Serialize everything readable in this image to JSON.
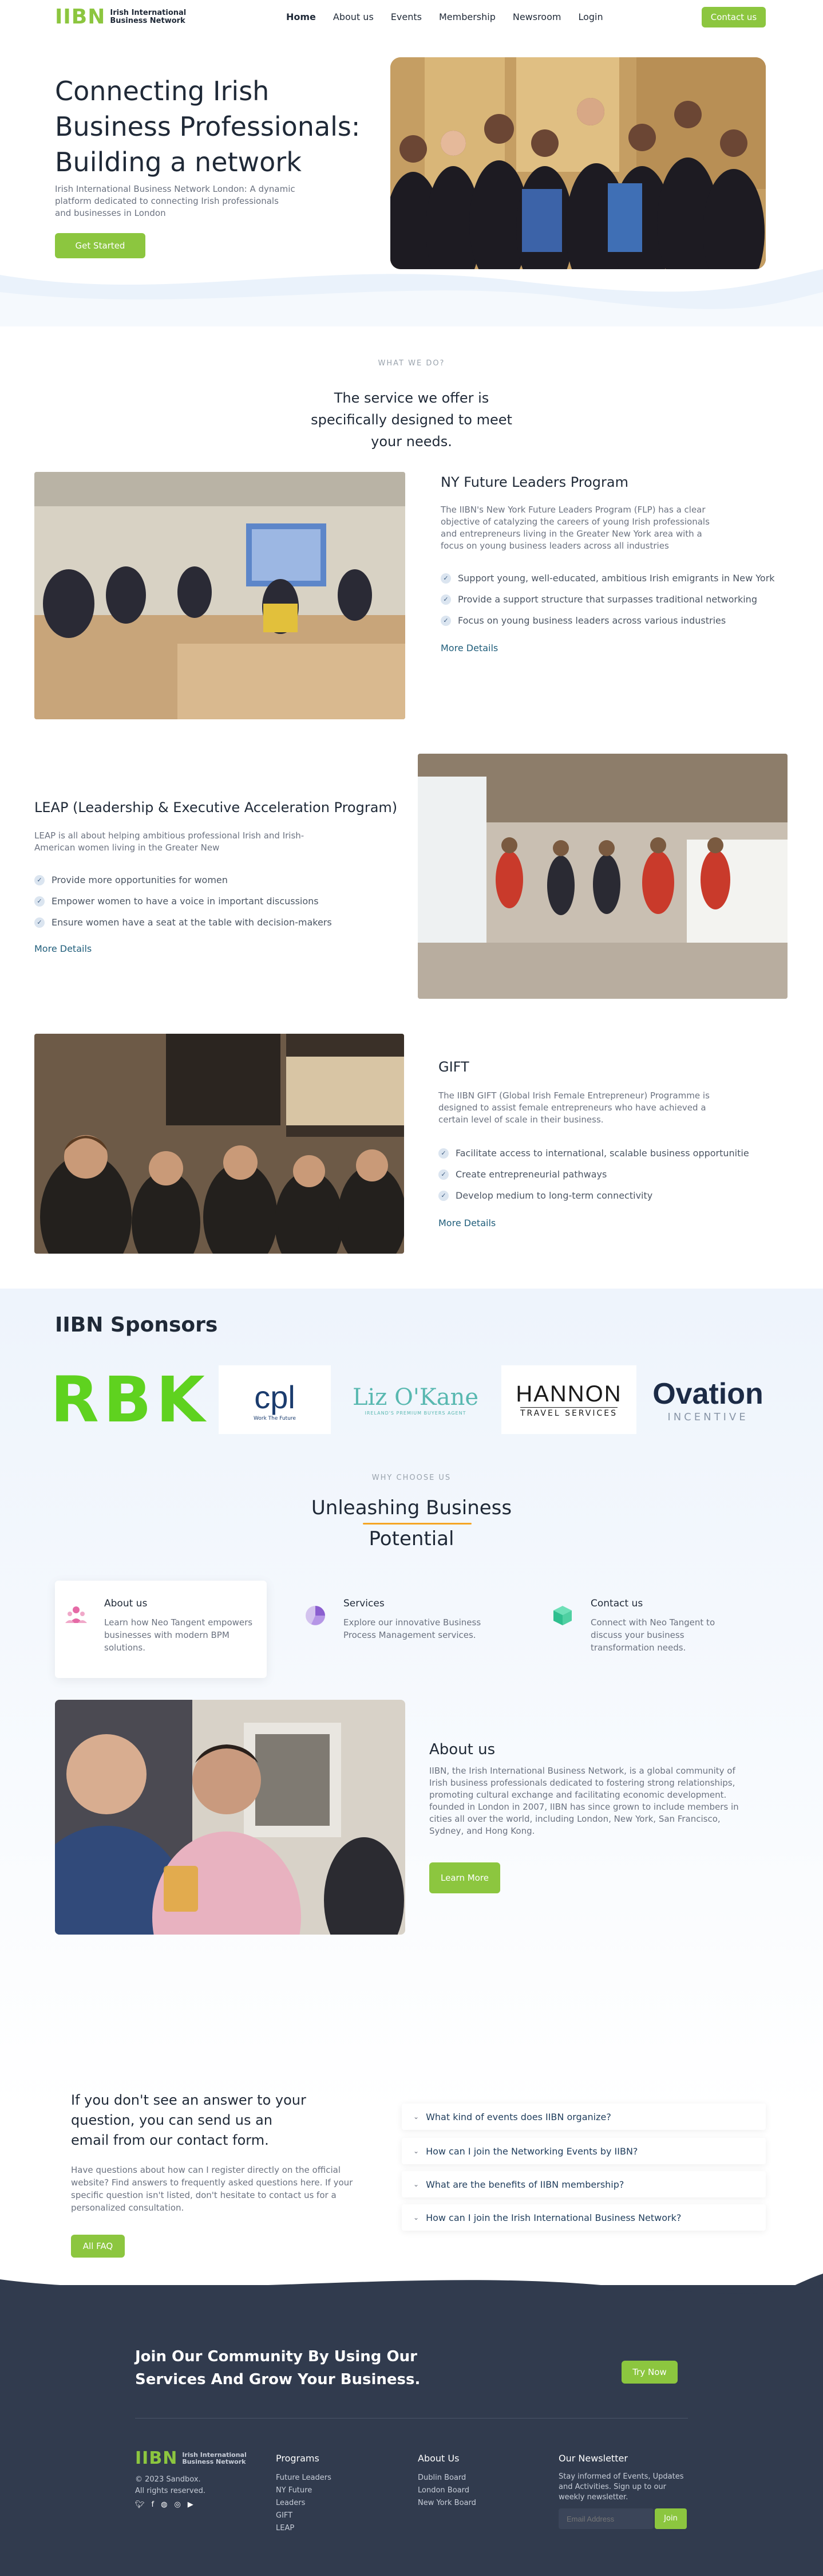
{
  "header": {
    "logo_mark": "IIBN",
    "logo_text_1": "Irish International",
    "logo_text_2": "Business Network",
    "nav": [
      "Home",
      "About us",
      "Events",
      "Membership",
      "Newsroom",
      "Login"
    ],
    "contact_label": "Contact us"
  },
  "hero": {
    "title": "Connecting Irish Business Professionals: Building a network",
    "subtitle": "Irish International Business Network London: A dynamic platform dedicated to connecting Irish professionals and businesses in London",
    "cta": "Get Started"
  },
  "services": {
    "eyebrow": "WHAT WE DO?",
    "title": "The service we offer is specifically designed to meet your needs."
  },
  "programs": [
    {
      "title": "NY Future Leaders Program",
      "desc": "The IIBN's New York Future Leaders Program (FLP) has a clear objective of catalyzing the careers of young Irish professionals and entrepreneurs living in the Greater New York area with a focus on young business leaders across all industries",
      "points": [
        "Support young, well-educated, ambitious Irish emigrants in New York",
        "Provide a support structure that surpasses traditional networking",
        "Focus on young business leaders across various industries"
      ],
      "more": "More Details"
    },
    {
      "title": "LEAP (Leadership & Executive Acceleration Program)",
      "desc": "LEAP is all about helping ambitious professional Irish and Irish-American women living in the Greater New",
      "points": [
        "Provide more opportunities for women",
        "Empower women to have a voice in important discussions",
        "Ensure women have a seat at the table with decision-makers"
      ],
      "more": "More Details"
    },
    {
      "title": "GIFT",
      "desc": "The IIBN GIFT (Global Irish Female Entrepreneur) Programme is designed to assist female entrepreneurs who have achieved a certain level of scale in their business.",
      "points": [
        "Facilitate access to international, scalable business opportunitie",
        "Create entrepreneurial pathways",
        "Develop medium to long-term connectivity"
      ],
      "more": "More Details"
    }
  ],
  "sponsors": {
    "title": "IIBN Sponsors",
    "logos": [
      {
        "name": "RBK",
        "text": "RBK"
      },
      {
        "name": "cpl",
        "text": "cpl",
        "sub": "Work The Future"
      },
      {
        "name": "liz-okane",
        "text": "Liz O'Kane",
        "sub": "IRELAND'S PREMIUM BUYERS AGENT"
      },
      {
        "name": "hannon",
        "text": "HANNON",
        "sub": "TRAVEL SERVICES"
      },
      {
        "name": "ovation",
        "text": "Ovation",
        "sub": "INCENTIVE"
      }
    ]
  },
  "why": {
    "eyebrow": "WHY CHOOSE US",
    "title_1": "Unleashing Business",
    "title_2": "Potential",
    "features": [
      {
        "title": "About us",
        "text": "Learn how Neo Tangent empowers businesses with modern BPM solutions.",
        "icon": "people-icon"
      },
      {
        "title": "Services",
        "text": "Explore our innovative Business Process Management services.",
        "icon": "pie-chart-icon"
      },
      {
        "title": "Contact us",
        "text": "Connect with Neo Tangent to discuss your business transformation needs.",
        "icon": "cube-icon"
      }
    ]
  },
  "about": {
    "title": "About us",
    "text": "IIBN, the Irish International Business Network, is a global community of Irish business professionals dedicated to fostering strong relationships, promoting cultural exchange and facilitating economic development. founded in London in 2007, IIBN has since grown to include members in cities all over the world, including London, New York, San Francisco, Sydney, and Hong Kong.",
    "cta": "Learn More"
  },
  "faq": {
    "heading": "If you don't see an answer to your question, you can send us an email from our contact form.",
    "text": "Have questions about how can I register directly on the official website?  Find answers to frequently asked questions here.  If your specific question isn't listed, don't hesitate to contact us for a personalized consultation.",
    "cta": "All FAQ",
    "items": [
      "What kind of events does IIBN organize?",
      "How can I join the Networking Events by IIBN?",
      "What are the benefits of IIBN membership?",
      "How can I join the Irish International Business Network?"
    ]
  },
  "footer": {
    "cta": "Join Our Community By Using Our Services And Grow Your Business.",
    "cta_btn": "Try Now",
    "copyright": "© 2023 Sandbox.",
    "rights": "All rights reserved.",
    "programs_title": "Programs",
    "programs": [
      "Future Leaders",
      "NY Future",
      "Leaders",
      "GIFT",
      "LEAP"
    ],
    "about_title": "About Us",
    "about_links": [
      "Dublin Board",
      "London Board",
      "New York Board"
    ],
    "newsletter_title": "Our Newsletter",
    "newsletter_text": "Stay informed of Events, Updates and Activities. Sign up to our weekly newsletter.",
    "email_placeholder": "Email Address",
    "join": "Join"
  },
  "colors": {
    "accent": "#8cc63f",
    "footer": "#313b4e",
    "link": "#1f5d7a"
  }
}
